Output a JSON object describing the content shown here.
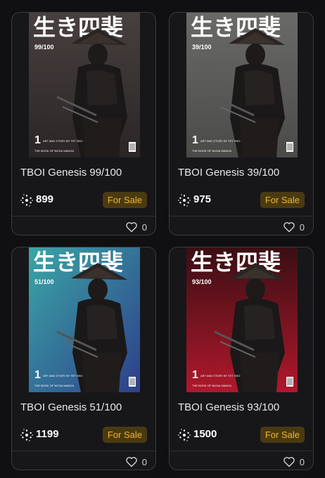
{
  "cards": [
    {
      "issue": "99/100",
      "title": "TBOI Genesis 99/100",
      "price": "899",
      "badge": "For Sale",
      "likes": "0",
      "bg_top": "#48403e",
      "bg_bottom": "#2a2526"
    },
    {
      "issue": "39/100",
      "title": "TBOI Genesis 39/100",
      "price": "975",
      "badge": "For Sale",
      "likes": "0",
      "bg_top": "#6a6a68",
      "bg_bottom": "#4a4a48"
    },
    {
      "issue": "51/100",
      "title": "TBOI Genesis 51/100",
      "price": "1199",
      "badge": "For Sale",
      "likes": "0",
      "bg_top": "#3aa6a6",
      "bg_bottom": "#2e3f8a"
    },
    {
      "issue": "93/100",
      "title": "TBOI Genesis 93/100",
      "price": "1500",
      "badge": "For Sale",
      "likes": "0",
      "bg_top": "#3a0f14",
      "bg_bottom": "#b0182c"
    }
  ],
  "cover": {
    "kanji": "生き四斐",
    "number": "1",
    "credit_line": "ART AND STORY BY TET SHO",
    "book_line": "THE BOOK OF IKIGAI MANGA"
  },
  "icons": {
    "currency": "cardano-coin-icon",
    "like": "heart-outline-icon"
  },
  "colors": {
    "badge_bg": "#4a3a12",
    "badge_text": "#f0b62a",
    "card_border": "#3a3a40",
    "page_bg": "#101012"
  }
}
